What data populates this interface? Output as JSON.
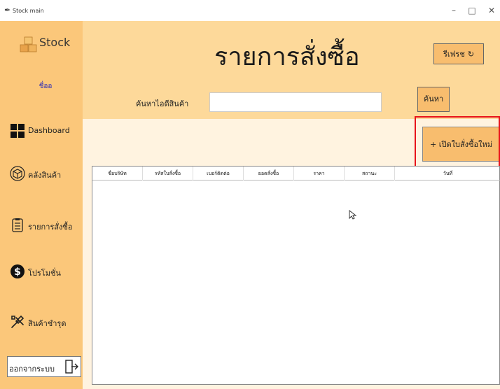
{
  "window": {
    "title": "Stock main",
    "minimize": "–",
    "maximize": "□",
    "close": "✕"
  },
  "sidebar": {
    "logo_text": "Stock",
    "username": "ชื่ออ",
    "items": [
      {
        "label": "Dashboard",
        "icon": "dashboard-grid-icon"
      },
      {
        "label": "คลังสินค้า",
        "icon": "box-icon"
      },
      {
        "label": "รายการสั่งซื้อ",
        "icon": "order-list-icon"
      },
      {
        "label": "โปรโมชั่น",
        "icon": "dollar-icon"
      },
      {
        "label": "สินค้าชำรุด",
        "icon": "tools-icon"
      }
    ],
    "logout_label": "ออกจากระบบ"
  },
  "header": {
    "title": "รายการสั่งซื้อ",
    "refresh_label": "รีเฟรช",
    "search_label": "ค้นหาไอดีสินค้า",
    "search_value": "",
    "search_button": "ค้นหา"
  },
  "actions": {
    "new_order_label": "+ เปิดใบสั่งซื้อใหม่"
  },
  "table": {
    "columns": [
      "ชื่อบริษัท",
      "รหัสใบสั่งซื้อ",
      "เบอร์ติดต่อ",
      "ยอดสั่งซื้อ",
      "ราคา",
      "สถานะ",
      "วันที่"
    ],
    "rows": []
  },
  "colors": {
    "sidebar": "#fbc77a",
    "header": "#fdd99a",
    "button": "#f8bd6e",
    "highlight": "#e8131b",
    "content": "#fff3e0"
  }
}
